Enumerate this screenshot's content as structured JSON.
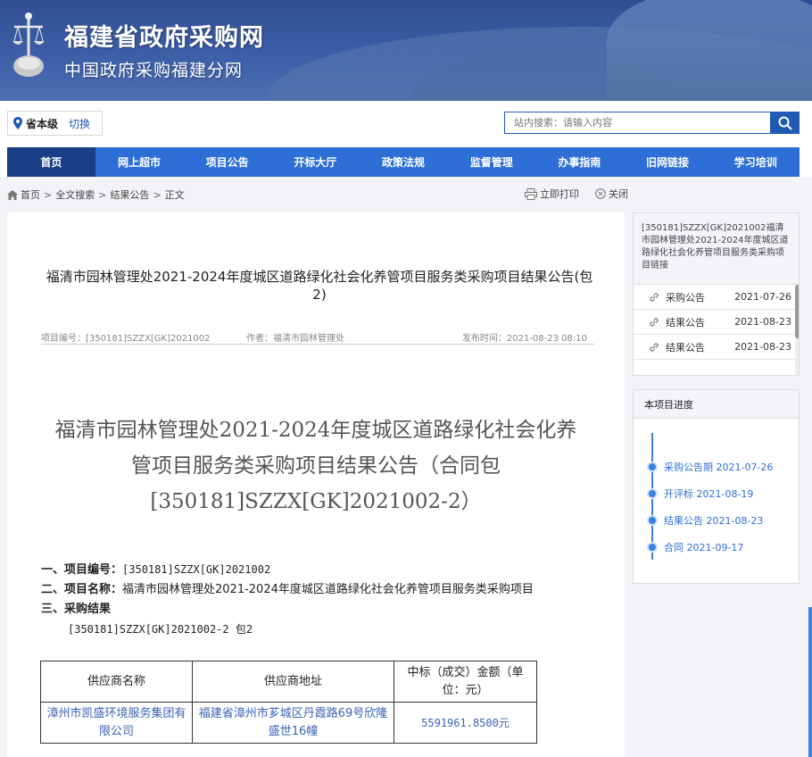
{
  "header": {
    "title": "福建省政府采购网",
    "subtitle": "中国政府采购福建分网"
  },
  "region": {
    "name": "省本级",
    "switch_label": "切换"
  },
  "search": {
    "placeholder": "站内搜索：请输入内容"
  },
  "nav": {
    "items": [
      "首页",
      "网上超市",
      "项目公告",
      "开标大厅",
      "政策法规",
      "监督管理",
      "办事指南",
      "旧网链接",
      "学习培训"
    ],
    "active": "首页"
  },
  "breadcrumb": [
    "首页",
    "全文搜索",
    "结果公告",
    "正文"
  ],
  "tools": {
    "print": "立即打印",
    "close": "关闭"
  },
  "article": {
    "title": "福清市园林管理处2021-2024年度城区道路绿化社会化养管项目服务类采购项目结果公告(包2)",
    "meta": {
      "project_no": "项目编号：[350181]SZZX[GK]2021002",
      "author": "作者：福清市园林管理处",
      "publish_time": "发布时间：2021-08-23 08:10"
    },
    "big_title": "福清市园林管理处2021-2024年度城区道路绿化社会化养管项目服务类采购项目结果公告（合同包[350181]SZZX[GK]2021002-2）",
    "section1_label": "一、项目编号：",
    "section1_value": "[350181]SZZX[GK]2021002",
    "section2_label": "二、项目名称：",
    "section2_value": "福清市园林管理处2021-2024年度城区道路绿化社会化养管项目服务类采购项目",
    "section3_label": "三、采购结果",
    "package_line": "[350181]SZZX[GK]2021002-2 包2",
    "table": {
      "headers": [
        "供应商名称",
        "供应商地址",
        "中标（成交）金额（单位：元）"
      ],
      "rows": [
        [
          "漳州市凯盛环境服务集团有限公司",
          "福建省漳州市芗城区丹霞路69号欣隆盛世16幢",
          "5591961.8500元"
        ]
      ]
    }
  },
  "related": {
    "heading": "[350181]SZZX[GK]2021002福清市园林管理处2021-2024年度城区道路绿化社会化养管项目服务类采购项目链接",
    "items": [
      {
        "label": "采购公告",
        "date": "2021-07-26"
      },
      {
        "label": "结果公告",
        "date": "2021-08-23"
      },
      {
        "label": "结果公告",
        "date": "2021-08-23"
      }
    ]
  },
  "progress": {
    "heading": "本项目进度",
    "steps": [
      {
        "label": "采购公告期 2021-07-26"
      },
      {
        "label": "开评标 2021-08-19"
      },
      {
        "label": "结果公告 2021-08-23"
      },
      {
        "label": "合同 2021-09-17"
      }
    ]
  },
  "colors": {
    "nav_bg": "#2d6fd6",
    "nav_active": "#1a3f86",
    "accent": "#1f5ab5",
    "link_blue": "#3a62b5",
    "banner": "#3d5fa8"
  }
}
